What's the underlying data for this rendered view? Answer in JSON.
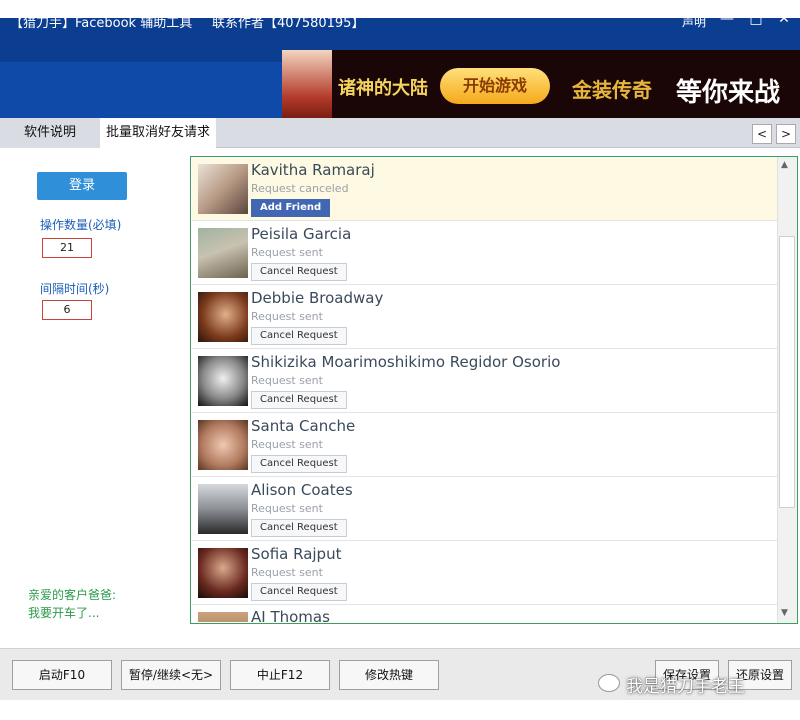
{
  "window": {
    "title": "【猎刀手】Facebook 辅助工具",
    "contact": "联系作者【407580195】",
    "declaration": "声明",
    "minimize": "—",
    "maximize": "□",
    "close": "✕"
  },
  "banner": {
    "game_title": "诸神的大陆",
    "play_label": "开始游戏",
    "brand": "金装传奇",
    "slogan": "等你来战"
  },
  "tabs": [
    {
      "label": "软件说明"
    },
    {
      "label": "批量取消好友请求"
    }
  ],
  "nav": {
    "prev": "<",
    "next": ">"
  },
  "left_panel": {
    "login_label": "登录",
    "count_label": "操作数量(必填)",
    "count_value": "21",
    "interval_label": "间隔时间(秒)",
    "interval_value": "6",
    "greeting_line1": "亲爱的客户爸爸:",
    "greeting_line2": "我要开车了..."
  },
  "friend_requests": [
    {
      "name": "Kavitha Ramaraj",
      "status": "Request canceled",
      "action": "Add Friend"
    },
    {
      "name": "Peisila Garcia",
      "status": "Request sent",
      "action": "Cancel Request"
    },
    {
      "name": "Debbie Broadway",
      "status": "Request sent",
      "action": "Cancel Request"
    },
    {
      "name": "Shikizika Moarimoshikimo Regidor Osorio",
      "status": "Request sent",
      "action": "Cancel Request"
    },
    {
      "name": "Santa Canche",
      "status": "Request sent",
      "action": "Cancel Request"
    },
    {
      "name": "Alison Coates",
      "status": "Request sent",
      "action": "Cancel Request"
    },
    {
      "name": "Sofia Rajput",
      "status": "Request sent",
      "action": "Cancel Request"
    },
    {
      "name": "AJ Thomas",
      "status": "",
      "action": ""
    }
  ],
  "bottom_buttons": {
    "start": "启动F10",
    "pause": "暂停/继续<无>",
    "stop": "中止F12",
    "hotkey": "修改热键",
    "save": "保存设置",
    "restore": "还原设置"
  },
  "watermark": "我是猎刀手老王",
  "colors": {
    "title_bar": "#0b3d91",
    "login_button": "#2f8fd9",
    "add_friend": "#4267b2",
    "list_border": "#3aa05a",
    "highlight_row": "#fdf9e2"
  }
}
